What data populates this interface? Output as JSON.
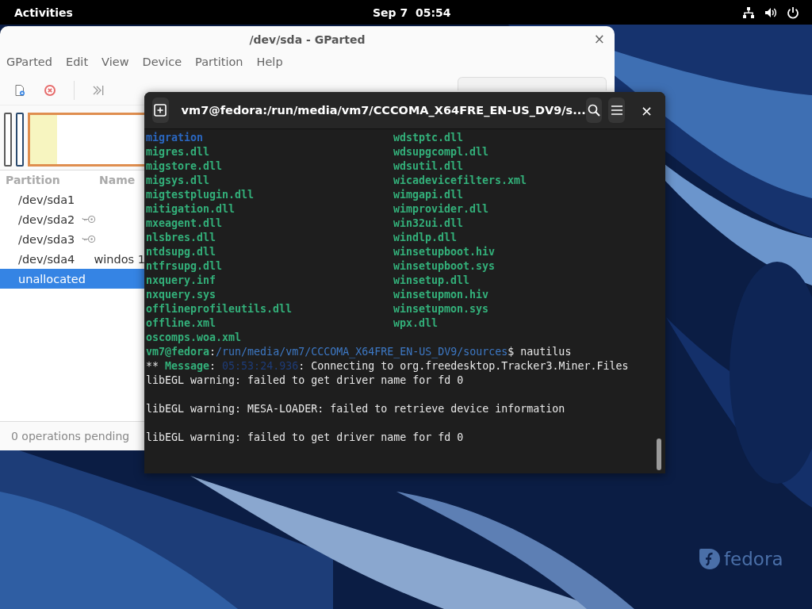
{
  "top_bar": {
    "activities": "Activities",
    "clock": "Sep 7  05:54"
  },
  "gparted": {
    "title": "/dev/sda - GParted",
    "close": "×",
    "menu": [
      "GParted",
      "Edit",
      "View",
      "Device",
      "Partition",
      "Help"
    ],
    "toolbar": [
      {
        "kind": "new"
      },
      {
        "kind": "delete"
      },
      {
        "kind": "apply"
      }
    ],
    "columns": [
      "Partition",
      "Name"
    ],
    "rows": [
      {
        "partition": "/dev/sda1",
        "active": false,
        "selected": false
      },
      {
        "partition": "/dev/sda2",
        "active": true,
        "selected": false
      },
      {
        "partition": "/dev/sda3",
        "active": true,
        "selected": false
      },
      {
        "partition": "/dev/sda4",
        "name": "windos 1",
        "active": false,
        "selected": false
      },
      {
        "partition": "unallocated",
        "active": false,
        "selected": true
      }
    ],
    "status": "0 operations pending"
  },
  "terminal": {
    "title": "vm7@fedora:/run/media/vm7/CCCOMA_X64FRE_EN-US_DV9/s...",
    "close": "×",
    "left_column": [
      {
        "text": "migration",
        "kind": "dir"
      },
      {
        "text": "migres.dll",
        "kind": "file"
      },
      {
        "text": "migstore.dll",
        "kind": "file"
      },
      {
        "text": "migsys.dll",
        "kind": "file"
      },
      {
        "text": "migtestplugin.dll",
        "kind": "file"
      },
      {
        "text": "mitigation.dll",
        "kind": "file"
      },
      {
        "text": "mxeagent.dll",
        "kind": "file"
      },
      {
        "text": "nlsbres.dll",
        "kind": "file"
      },
      {
        "text": "ntdsupg.dll",
        "kind": "file"
      },
      {
        "text": "ntfrsupg.dll",
        "kind": "file"
      },
      {
        "text": "nxquery.inf",
        "kind": "file"
      },
      {
        "text": "nxquery.sys",
        "kind": "file"
      },
      {
        "text": "offlineprofileutils.dll",
        "kind": "file"
      },
      {
        "text": "offline.xml",
        "kind": "file"
      },
      {
        "text": "oscomps.woa.xml",
        "kind": "file"
      }
    ],
    "right_column": [
      {
        "text": "wdstptc.dll",
        "kind": "file"
      },
      {
        "text": "wdsupgcompl.dll",
        "kind": "file"
      },
      {
        "text": "wdsutil.dll",
        "kind": "file"
      },
      {
        "text": "wicadevicefilters.xml",
        "kind": "file"
      },
      {
        "text": "wimgapi.dll",
        "kind": "file"
      },
      {
        "text": "wimprovider.dll",
        "kind": "file"
      },
      {
        "text": "win32ui.dll",
        "kind": "file"
      },
      {
        "text": "windlp.dll",
        "kind": "file"
      },
      {
        "text": "winsetupboot.hiv",
        "kind": "file"
      },
      {
        "text": "winsetupboot.sys",
        "kind": "file"
      },
      {
        "text": "winsetup.dll",
        "kind": "file"
      },
      {
        "text": "winsetupmon.hiv",
        "kind": "file"
      },
      {
        "text": "winsetupmon.sys",
        "kind": "file"
      },
      {
        "text": "wpx.dll",
        "kind": "file"
      }
    ],
    "output": [
      {
        "kind": "text",
        "segments": [
          {
            "text": "vm7@fedora",
            "kind": "user"
          },
          {
            "text": ":",
            "kind": "plain"
          },
          {
            "text": "/run/media/vm7/CCCOMA_X64FRE_EN-US_DV9/sources",
            "kind": "path"
          },
          {
            "text": "$ nautilus",
            "kind": "plain"
          }
        ]
      },
      {
        "kind": "text",
        "segments": [
          {
            "text": "** ",
            "kind": "plain"
          },
          {
            "text": "Message",
            "kind": "user"
          },
          {
            "text": ": ",
            "kind": "plain"
          },
          {
            "text": "05:53:24.936",
            "kind": "timestamp"
          },
          {
            "text": ": Connecting to org.freedesktop.Tracker3.Miner.Files",
            "kind": "plain"
          }
        ]
      },
      {
        "kind": "text",
        "segments": [
          {
            "text": "libEGL warning: failed to get driver name for fd 0",
            "kind": "plain"
          }
        ]
      },
      {
        "kind": "blank"
      },
      {
        "kind": "text",
        "segments": [
          {
            "text": "libEGL warning: MESA-LOADER: failed to retrieve device information",
            "kind": "plain"
          }
        ]
      },
      {
        "kind": "blank"
      },
      {
        "kind": "text",
        "segments": [
          {
            "text": "libEGL warning: failed to get driver name for fd 0",
            "kind": "plain"
          }
        ]
      }
    ]
  },
  "wallpaper_logo": "fedora"
}
